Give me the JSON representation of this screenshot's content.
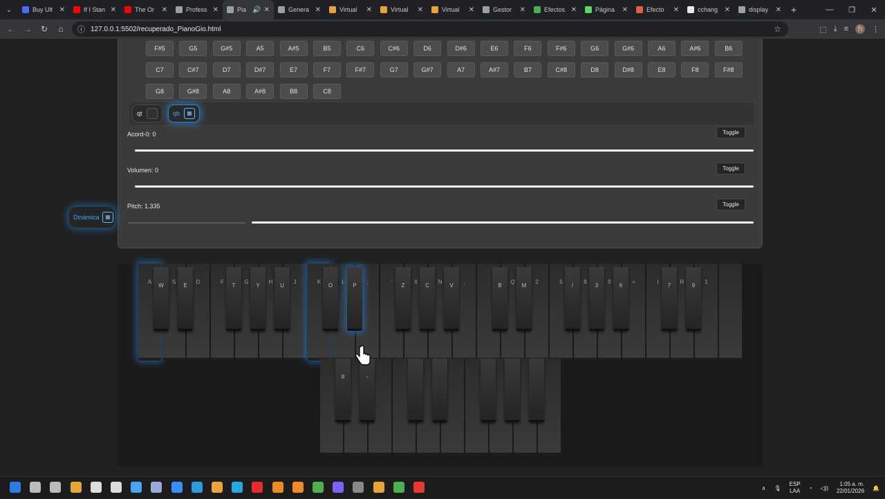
{
  "tabs": [
    {
      "title": "Buy Ult",
      "color": "#4a6cf7"
    },
    {
      "title": "If I Stan",
      "color": "#ff0000"
    },
    {
      "title": "The Or",
      "color": "#ff0000"
    },
    {
      "title": "Profess",
      "color": "#9aa0a6"
    },
    {
      "title": "Pia",
      "color": "#9aa0a6",
      "active": true
    },
    {
      "title": "Genera",
      "color": "#9aa0a6"
    },
    {
      "title": "Virtual",
      "color": "#e8a33a"
    },
    {
      "title": "Virtual",
      "color": "#e8a33a"
    },
    {
      "title": "Virtual",
      "color": "#e8a33a"
    },
    {
      "title": "Gestor",
      "color": "#9aa0a6"
    },
    {
      "title": "Efectos",
      "color": "#4caf50"
    },
    {
      "title": "Página",
      "color": "#5cd65c"
    },
    {
      "title": "Efecto",
      "color": "#e06040"
    },
    {
      "title": "cchang",
      "color": "#e8e8e8"
    },
    {
      "title": "display",
      "color": "#9aa0a6"
    }
  ],
  "address": {
    "url": "127.0.0.1:5502/recuperado_PianoGio.html"
  },
  "notes": {
    "row1": [
      "F#5",
      "G5",
      "G#5",
      "A5",
      "A#5",
      "B5",
      "C6",
      "C#6",
      "D6",
      "D#6",
      "E6",
      "F6",
      "F#6",
      "G6",
      "G#6",
      "A6",
      "A#6",
      "B6"
    ],
    "row2": [
      "C7",
      "C#7",
      "D7",
      "D#7",
      "E7",
      "F7",
      "F#7",
      "G7",
      "G#7",
      "A7",
      "A#7",
      "B7",
      "C#8",
      "D8",
      "D#8",
      "E8",
      "F8",
      "F#8"
    ],
    "row3": [
      "G8",
      "G#8",
      "A8",
      "A#8",
      "B8",
      "C8"
    ]
  },
  "chips": {
    "qt": "qt",
    "qb": "qb"
  },
  "sliders": [
    {
      "label": "Acord-0: 0",
      "toggle": "Toggle"
    },
    {
      "label": "Volumen: 0",
      "toggle": "Toggle"
    },
    {
      "label": "Pitch: 1.335",
      "toggle": "Toggle"
    }
  ],
  "dinamica": "Dinámica",
  "piano": {
    "black_labels_top": [
      "W",
      "E",
      "T",
      "Y",
      "U",
      "O",
      "P",
      "Z",
      "C",
      "V",
      "B",
      "M",
      "/",
      "3",
      "6",
      "7",
      "9",
      "[",
      "]",
      "4"
    ],
    "white_labels_top": [
      "A",
      "S",
      "D",
      "F",
      "G",
      "H",
      "J",
      "K",
      "L",
      ";",
      "'",
      "X",
      "N",
      ",",
      ".",
      "Q",
      "2",
      "5",
      "8",
      "0",
      "=",
      "I",
      "R",
      "1"
    ],
    "bottom_labels": [
      "8",
      "-"
    ]
  },
  "taskbar": {
    "lang": "ESP",
    "lang2": "LAA",
    "time": "1:05 a. m.",
    "date": "22/01/2026"
  }
}
